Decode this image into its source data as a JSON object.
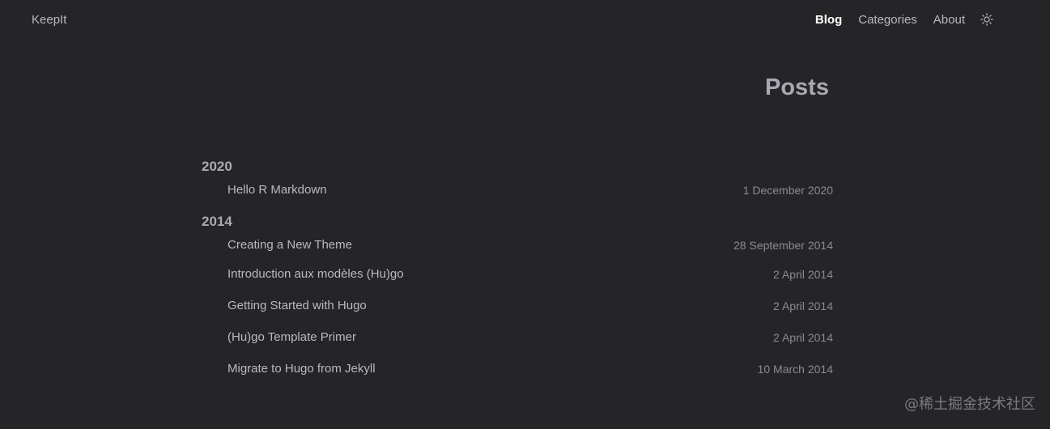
{
  "site": {
    "logo": "KeepIt"
  },
  "nav": {
    "items": [
      {
        "label": "Blog",
        "active": true
      },
      {
        "label": "Categories",
        "active": false
      },
      {
        "label": "About",
        "active": false
      }
    ],
    "theme_icon": "sun-icon"
  },
  "page": {
    "title": "Posts"
  },
  "archive": [
    {
      "year": "2020",
      "posts": [
        {
          "title": "Hello R Markdown",
          "date": "1 December 2020"
        }
      ]
    },
    {
      "year": "2014",
      "posts": [
        {
          "title": "Creating a New Theme",
          "date": "28 September 2014"
        },
        {
          "title": "Introduction aux modèles (Hu)go",
          "date": "2 April 2014"
        },
        {
          "title": "Getting Started with Hugo",
          "date": "2 April 2014"
        },
        {
          "title": "(Hu)go Template Primer",
          "date": "2 April 2014"
        },
        {
          "title": "Migrate to Hugo from Jekyll",
          "date": "10 March 2014"
        }
      ]
    }
  ],
  "watermark": "@稀土掘金技术社区",
  "colors": {
    "background": "#252527",
    "text": "#a9a9b3",
    "active_nav": "#ffffff"
  }
}
